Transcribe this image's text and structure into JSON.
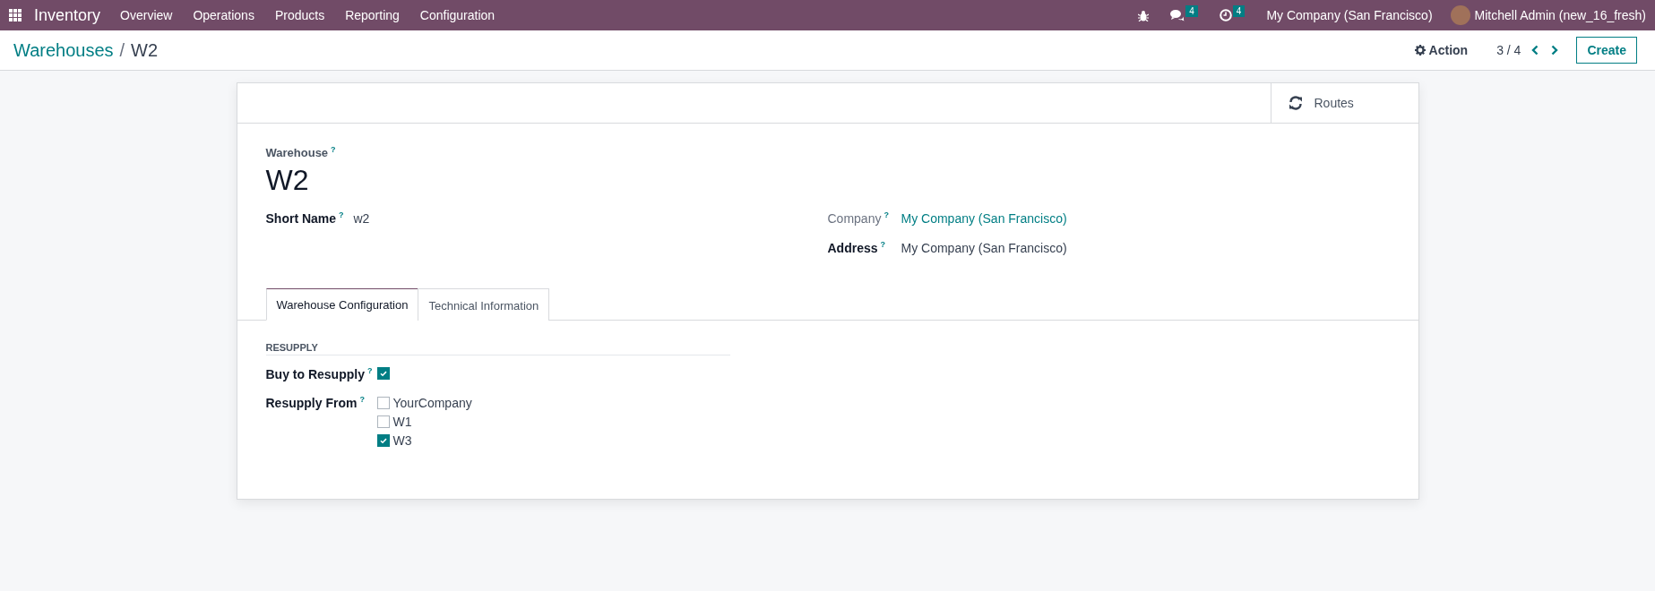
{
  "navbar": {
    "app_name": "Inventory",
    "menu": [
      "Overview",
      "Operations",
      "Products",
      "Reporting",
      "Configuration"
    ],
    "messages_count": "4",
    "activities_count": "4",
    "company": "My Company (San Francisco)",
    "user": "Mitchell Admin (new_16_fresh)"
  },
  "breadcrumb": {
    "parent": "Warehouses",
    "separator": "/",
    "current": "W2"
  },
  "control_panel": {
    "action": "Action",
    "pager": "3 / 4",
    "create": "Create"
  },
  "form": {
    "smart_buttons": [
      {
        "label": "Routes"
      }
    ],
    "title_label": {
      "text": "Warehouse",
      "help": "?"
    },
    "title": "W2",
    "left_fields": [
      {
        "label": "Short Name",
        "help": "?",
        "value": "w2",
        "kind": "text",
        "readonly": false
      }
    ],
    "right_fields": [
      {
        "label": "Company",
        "help": "?",
        "value": "My Company (San Francisco)",
        "kind": "link",
        "readonly": true
      },
      {
        "label": "Address",
        "help": "?",
        "value": "My Company (San Francisco)",
        "kind": "text",
        "readonly": false
      }
    ],
    "tabs": [
      {
        "label": "Warehouse Configuration",
        "selected": true
      },
      {
        "label": "Technical Information",
        "selected": false
      }
    ],
    "section": {
      "title": "RESUPPLY",
      "fields": [
        {
          "label": "Buy to Resupply",
          "help": "?",
          "kind": "checkbox",
          "checked": true
        },
        {
          "label": "Resupply From",
          "help": "?",
          "kind": "checklist",
          "options": [
            {
              "label": "YourCompany",
              "checked": false
            },
            {
              "label": "W1",
              "checked": false
            },
            {
              "label": "W3",
              "checked": true
            }
          ]
        }
      ]
    }
  }
}
